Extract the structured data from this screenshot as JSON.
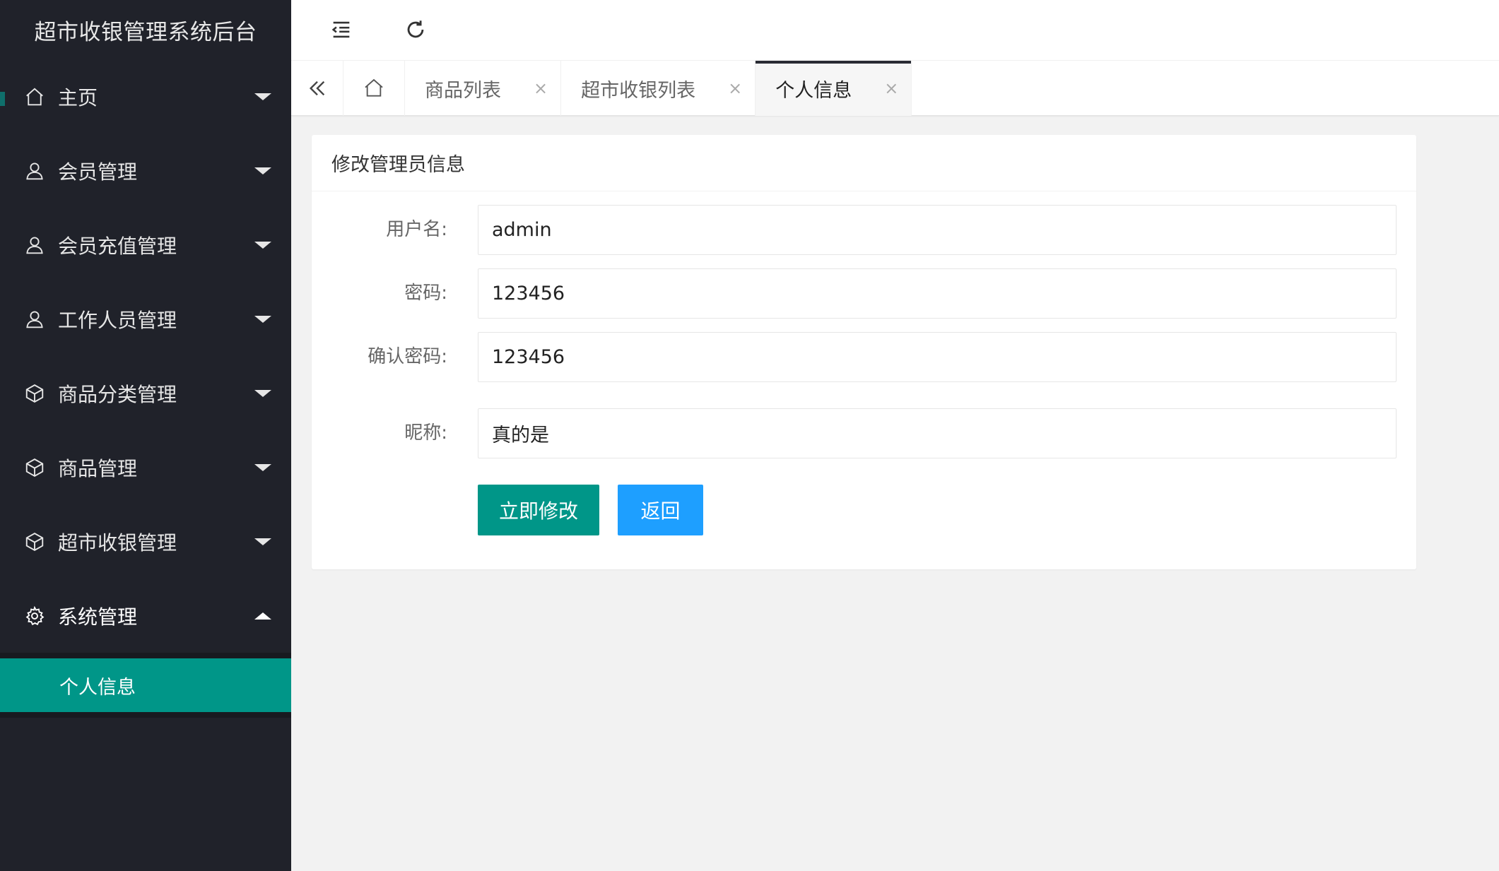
{
  "app": {
    "title": "超市收银管理系统后台"
  },
  "sidebar": {
    "items": [
      {
        "label": "主页",
        "icon": "home-icon"
      },
      {
        "label": "会员管理",
        "icon": "user-icon"
      },
      {
        "label": "会员充值管理",
        "icon": "user-icon"
      },
      {
        "label": "工作人员管理",
        "icon": "user-icon"
      },
      {
        "label": "商品分类管理",
        "icon": "box-icon"
      },
      {
        "label": "商品管理",
        "icon": "box-icon"
      },
      {
        "label": "超市收银管理",
        "icon": "box-icon"
      },
      {
        "label": "系统管理",
        "icon": "gear-icon"
      }
    ],
    "sub_items": [
      {
        "label": "个人信息"
      }
    ]
  },
  "header": {
    "collapse_icon": "indent-icon",
    "refresh_icon": "refresh-icon"
  },
  "tabs": {
    "items": [
      {
        "label": "商品列表",
        "close": "×"
      },
      {
        "label": "超市收银列表",
        "close": "×"
      },
      {
        "label": "个人信息",
        "close": "×"
      }
    ],
    "active": "个人信息"
  },
  "form": {
    "title": "修改管理员信息",
    "fields": [
      {
        "label": "用户名:",
        "value": "admin"
      },
      {
        "label": "密码:",
        "value": "123456"
      },
      {
        "label": "确认密码:",
        "value": "123456"
      },
      {
        "label": "昵称:",
        "value": "真的是"
      }
    ],
    "submit_label": "立即修改",
    "back_label": "返回"
  },
  "colors": {
    "sidebar_bg": "#20222a",
    "accent": "#009688",
    "secondary_button": "#1e9fff"
  }
}
